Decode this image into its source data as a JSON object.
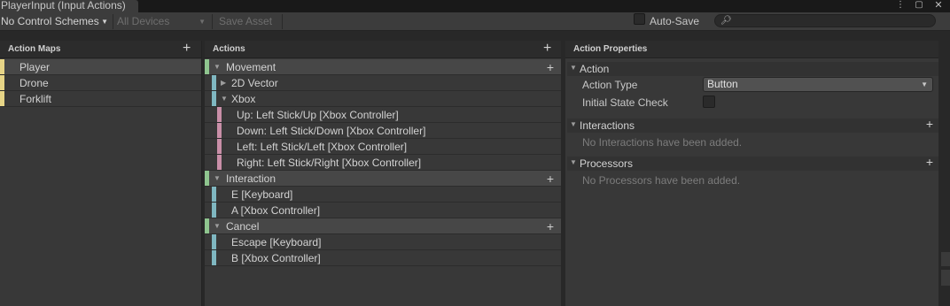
{
  "window": {
    "tab_title": "PlayerInput (Input Actions)",
    "menu_icon": "kebab-menu-icon",
    "maximize_icon": "maximize-icon",
    "close_icon": "close-icon"
  },
  "toolbar": {
    "control_schemes": "No Control Schemes",
    "devices": "All Devices",
    "save_asset": "Save Asset",
    "auto_save_label": "Auto-Save",
    "auto_save_checked": false,
    "search_value": ""
  },
  "action_maps": {
    "header": "Action Maps",
    "add_icon": "plus-icon",
    "items": [
      {
        "label": "Player",
        "selected": true
      },
      {
        "label": "Drone",
        "selected": false
      },
      {
        "label": "Forklift",
        "selected": false
      }
    ]
  },
  "actions": {
    "header": "Actions",
    "add_icon": "plus-icon",
    "rows": [
      {
        "label": "Movement",
        "kind": "action"
      },
      {
        "label": "2D Vector",
        "kind": "composite"
      },
      {
        "label": "Xbox",
        "kind": "composite"
      },
      {
        "label": "Up: Left Stick/Up [Xbox Controller]",
        "kind": "part"
      },
      {
        "label": "Down: Left Stick/Down [Xbox Controller]",
        "kind": "part"
      },
      {
        "label": "Left: Left Stick/Left [Xbox Controller]",
        "kind": "part"
      },
      {
        "label": "Right: Left Stick/Right [Xbox Controller]",
        "kind": "part"
      },
      {
        "label": "Interaction",
        "kind": "action"
      },
      {
        "label": "E [Keyboard]",
        "kind": "binding"
      },
      {
        "label": "A [Xbox Controller]",
        "kind": "binding"
      },
      {
        "label": "Cancel",
        "kind": "action"
      },
      {
        "label": "Escape [Keyboard]",
        "kind": "binding"
      },
      {
        "label": "B [Xbox Controller]",
        "kind": "binding"
      }
    ]
  },
  "properties": {
    "header": "Action Properties",
    "action_section": "Action",
    "action_type_label": "Action Type",
    "action_type_value": "Button",
    "initial_state_label": "Initial State Check",
    "initial_state_checked": false,
    "interactions_section": "Interactions",
    "interactions_empty": "No Interactions have been added.",
    "processors_section": "Processors",
    "processors_empty": "No Processors have been added."
  },
  "colors": {
    "map_stripe": "#e7d587",
    "action_stripe": "#8fc58f",
    "binding_stripe": "#7fb7c1",
    "part_stripe": "#c98fa8"
  }
}
